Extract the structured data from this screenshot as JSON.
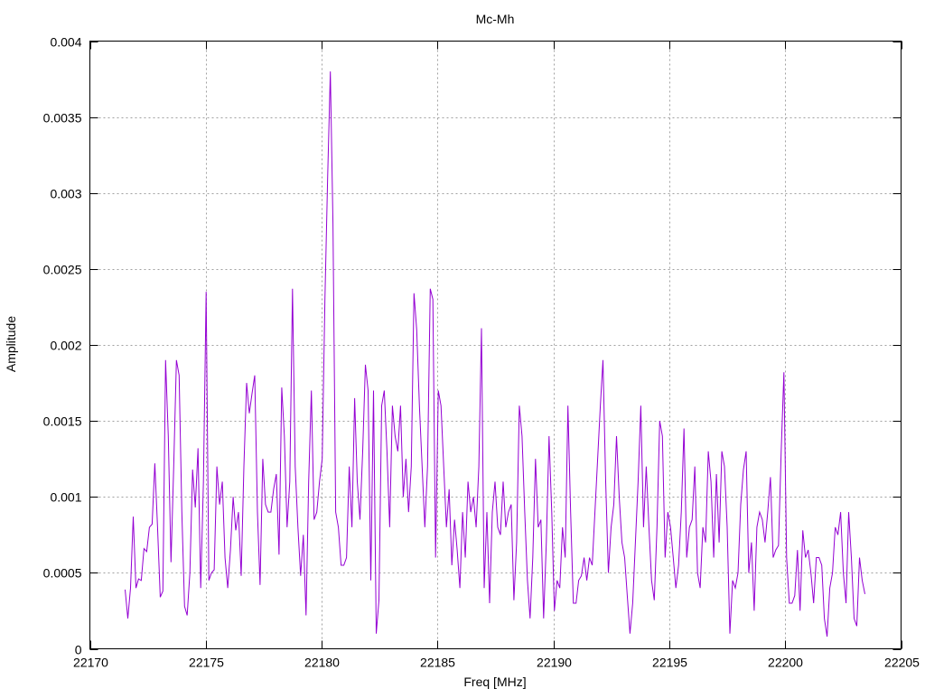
{
  "chart_data": {
    "type": "line",
    "title": "Mc-Mh",
    "xlabel": "Freq [MHz]",
    "ylabel": "Amplitude",
    "xlim": [
      22170,
      22205
    ],
    "ylim": [
      0,
      0.004
    ],
    "grid": true,
    "legend": "none",
    "xticks": [
      "22170",
      "22175",
      "22180",
      "22185",
      "22190",
      "22195",
      "22200",
      "22205"
    ],
    "xtick_values": [
      22170,
      22175,
      22180,
      22185,
      22190,
      22195,
      22200,
      22205
    ],
    "yticks": [
      "0",
      "0.0005",
      "0.001",
      "0.0015",
      "0.002",
      "0.0025",
      "0.003",
      "0.0035",
      "0.004"
    ],
    "ytick_values": [
      0,
      0.0005,
      0.001,
      0.0015,
      0.002,
      0.0025,
      0.003,
      0.0035,
      0.004
    ],
    "series": [
      {
        "name": "Mc-Mh",
        "color": "#9400d3",
        "x_start": 22171.52,
        "x_end": 22203.44,
        "values": [
          0.00039,
          0.0002,
          0.0004,
          0.00087,
          0.0004,
          0.00046,
          0.00045,
          0.00066,
          0.00064,
          0.0008,
          0.00082,
          0.00122,
          0.0008,
          0.00034,
          0.00038,
          0.0019,
          0.0014,
          0.00057,
          0.0012,
          0.0019,
          0.0018,
          0.0009,
          0.00028,
          0.00022,
          0.0005,
          0.00118,
          0.00093,
          0.00132,
          0.0004,
          0.0011,
          0.00235,
          0.00045,
          0.0005,
          0.00052,
          0.0012,
          0.00095,
          0.0011,
          0.0006,
          0.0004,
          0.00065,
          0.001,
          0.00078,
          0.0009,
          0.00048,
          0.0012,
          0.00175,
          0.00155,
          0.00168,
          0.0018,
          0.0009,
          0.00042,
          0.00125,
          0.00095,
          0.0009,
          0.0009,
          0.00105,
          0.00115,
          0.00062,
          0.00172,
          0.0014,
          0.0008,
          0.0011,
          0.00237,
          0.0012,
          0.0008,
          0.00048,
          0.00075,
          0.00022,
          0.0011,
          0.0017,
          0.00085,
          0.0009,
          0.0011,
          0.00125,
          0.0023,
          0.0031,
          0.0038,
          0.0028,
          0.0009,
          0.0008,
          0.00055,
          0.00055,
          0.0006,
          0.0012,
          0.0008,
          0.00165,
          0.0011,
          0.00085,
          0.0013,
          0.00187,
          0.0017,
          0.00045,
          0.0017,
          0.0001,
          0.00032,
          0.0016,
          0.0017,
          0.0013,
          0.0008,
          0.0016,
          0.0014,
          0.0013,
          0.0016,
          0.001,
          0.00125,
          0.0009,
          0.0012,
          0.00234,
          0.0021,
          0.0016,
          0.0012,
          0.0008,
          0.0012,
          0.00237,
          0.0023,
          0.0006,
          0.0017,
          0.0016,
          0.0012,
          0.0008,
          0.00105,
          0.00055,
          0.00085,
          0.00065,
          0.0004,
          0.0009,
          0.0006,
          0.0011,
          0.0009,
          0.001,
          0.0008,
          0.0012,
          0.00211,
          0.0004,
          0.0009,
          0.0003,
          0.0009,
          0.0011,
          0.0008,
          0.00075,
          0.0011,
          0.0008,
          0.0009,
          0.00095,
          0.00032,
          0.0007,
          0.0016,
          0.0014,
          0.0009,
          0.00045,
          0.0002,
          0.0006,
          0.00125,
          0.0008,
          0.00085,
          0.0002,
          0.0007,
          0.0014,
          0.0009,
          0.00025,
          0.00045,
          0.0004,
          0.0008,
          0.0006,
          0.0016,
          0.0009,
          0.0003,
          0.0003,
          0.00045,
          0.00048,
          0.0006,
          0.00045,
          0.0006,
          0.00055,
          0.0009,
          0.00125,
          0.0016,
          0.0019,
          0.0011,
          0.0005,
          0.0008,
          0.00095,
          0.0014,
          0.001,
          0.0007,
          0.0006,
          0.00035,
          0.0001,
          0.0003,
          0.0007,
          0.0011,
          0.0016,
          0.0008,
          0.0012,
          0.0008,
          0.00045,
          0.00032,
          0.0008,
          0.0015,
          0.0014,
          0.0006,
          0.0009,
          0.0008,
          0.0006,
          0.0004,
          0.00055,
          0.0009,
          0.00145,
          0.0006,
          0.0008,
          0.00085,
          0.0012,
          0.0005,
          0.0004,
          0.0008,
          0.0007,
          0.0013,
          0.0011,
          0.0006,
          0.00115,
          0.0007,
          0.0013,
          0.0012,
          0.0008,
          0.0001,
          0.00045,
          0.0004,
          0.0005,
          0.00095,
          0.00118,
          0.0013,
          0.0005,
          0.0007,
          0.00025,
          0.0008,
          0.0009,
          0.00085,
          0.0007,
          0.0009,
          0.00113,
          0.0006,
          0.00065,
          0.00068,
          0.0013,
          0.00182,
          0.0006,
          0.0003,
          0.0003,
          0.00035,
          0.00065,
          0.00025,
          0.00078,
          0.0006,
          0.00065,
          0.0005,
          0.0003,
          0.0006,
          0.0006,
          0.00055,
          0.0002,
          8e-05,
          0.0004,
          0.0005,
          0.0008,
          0.00075,
          0.0009,
          0.0005,
          0.0003,
          0.0009,
          0.0006,
          0.0002,
          0.00015,
          0.0006,
          0.00045,
          0.00036
        ]
      }
    ]
  }
}
